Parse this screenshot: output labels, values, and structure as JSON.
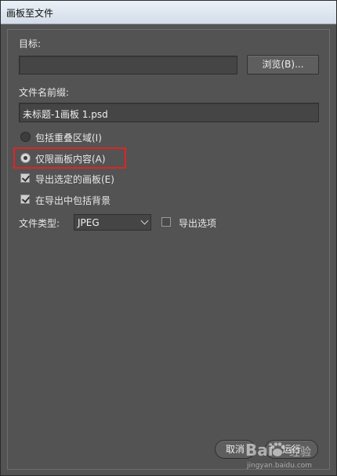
{
  "window": {
    "title": "画板至文件"
  },
  "destination": {
    "label": "目标:",
    "value": "",
    "browse_label": "浏览(B)..."
  },
  "prefix": {
    "label": "文件名前缀:",
    "value": "未标题-1画板 1.psd"
  },
  "options": {
    "include_overlap_label": "包括重叠区域(I)",
    "include_overlap_selected": false,
    "content_only_label": "仅限画板内容(A)",
    "content_only_selected": true,
    "export_selected_label": "导出选定的画板(E)",
    "export_selected_checked": true,
    "include_background_label": "在导出中包括背景",
    "include_background_checked": true
  },
  "file_type": {
    "label": "文件类型:",
    "selected": "JPEG",
    "export_options_label": "导出选项",
    "export_options_checked": false
  },
  "footer": {
    "cancel_label": "取消",
    "run_label": "运行"
  },
  "watermark": {
    "brand": "Bai",
    "brand_cn": "经验",
    "url": "jingyan.baidu.com"
  },
  "colors": {
    "highlight": "#e02424",
    "panel": "#535353"
  }
}
